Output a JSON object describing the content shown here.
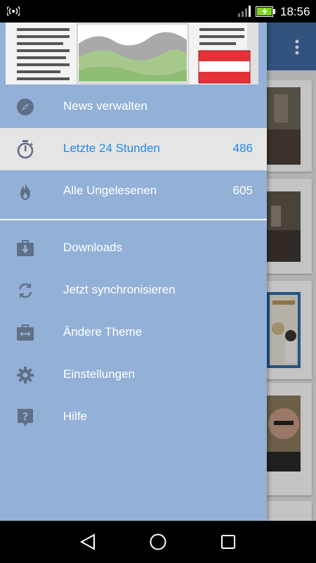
{
  "status_bar": {
    "time": "18:56",
    "icons": [
      "hotspot-icon",
      "signal-icon",
      "battery-charging-icon"
    ]
  },
  "drawer": {
    "header_image": "austrian-news-newspaper-logo",
    "items": [
      {
        "label": "News verwalten",
        "icon": "compass-icon",
        "count": ""
      },
      {
        "label": "Letzte 24 Stunden",
        "icon": "timer-icon",
        "count": "486",
        "selected": true
      },
      {
        "label": "Alle Ungelesenen",
        "icon": "flame-icon",
        "count": "605"
      },
      {
        "label": "Downloads",
        "icon": "download-briefcase-icon",
        "count": ""
      },
      {
        "label": "Jetzt synchronisieren",
        "icon": "sync-icon",
        "count": ""
      },
      {
        "label": "Ändere Theme",
        "icon": "theme-swap-icon",
        "count": ""
      },
      {
        "label": "Einstellungen",
        "icon": "gear-icon",
        "count": ""
      },
      {
        "label": "Hilfe",
        "icon": "help-icon",
        "count": ""
      }
    ]
  },
  "colors": {
    "drawer_bg": "#93b1d7",
    "active_bg": "#e5e5e5",
    "active_text": "#1e88e5",
    "app_bar": "#3f6ba4",
    "icon_color": "#5f6f85"
  },
  "nav_bar": {
    "buttons": [
      "back-icon",
      "home-icon",
      "recents-icon"
    ]
  }
}
